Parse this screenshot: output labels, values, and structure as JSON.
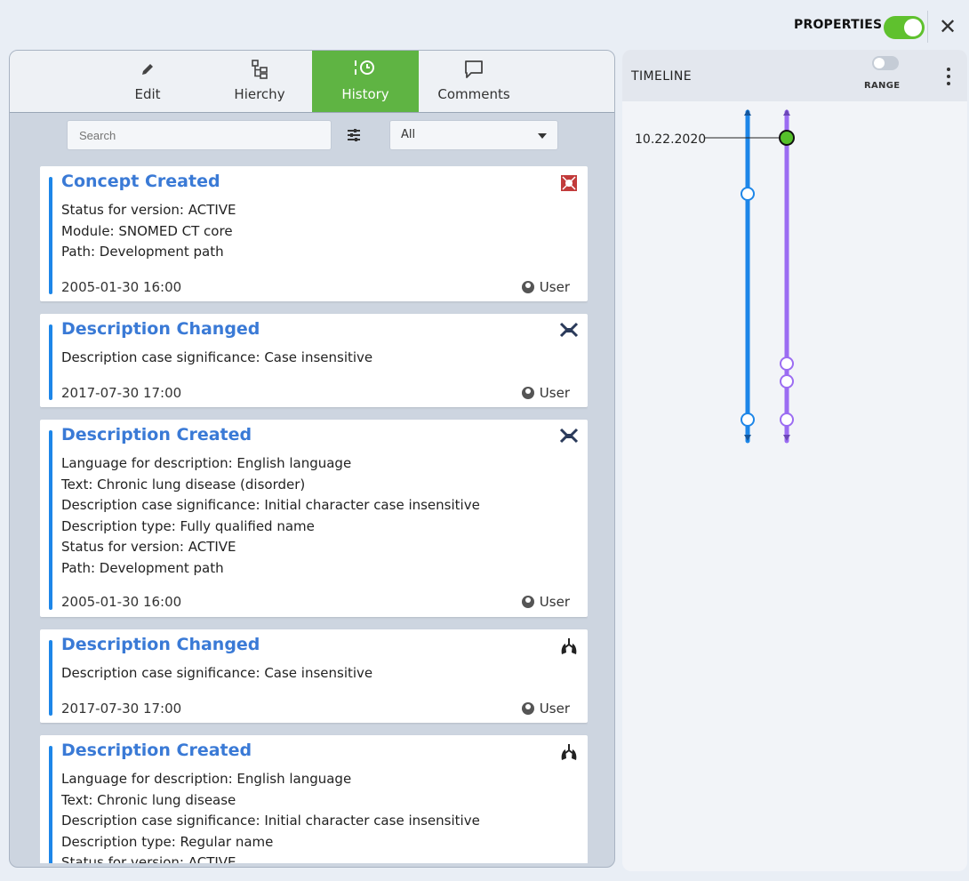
{
  "topbar": {
    "properties_label": "PROPERTIES",
    "properties_on": true,
    "close_glyph": "✕"
  },
  "tabs": [
    {
      "label": "Edit",
      "icon": "pencil-icon",
      "active": false
    },
    {
      "label": "Hierchy",
      "icon": "hierarchy-icon",
      "active": false
    },
    {
      "label": "History",
      "icon": "history-icon",
      "active": true
    },
    {
      "label": "Comments",
      "icon": "comment-icon",
      "active": false
    }
  ],
  "search": {
    "placeholder": "Search"
  },
  "filter": {
    "selected": "All"
  },
  "history": [
    {
      "title": "Concept Created",
      "icon": "concept-icon",
      "lines": [
        "Status for version: ACTIVE",
        "Module: SNOMED CT core",
        "Path: Development path"
      ],
      "date": "2005-01-30 16:00",
      "user": "User"
    },
    {
      "title": "Description Changed",
      "icon": "description-icon",
      "lines": [
        "Description case significance: Case insensitive"
      ],
      "date": "2017-07-30 17:00",
      "user": "User"
    },
    {
      "title": "Description Created",
      "icon": "description-icon",
      "lines": [
        "Language for description: English language",
        "Text: Chronic lung disease (disorder)",
        "Description case significance: Initial character case insensitive",
        "Description type: Fully qualified name",
        "Status for version: ACTIVE",
        "Path: Development path"
      ],
      "date": "2005-01-30 16:00",
      "user": "User"
    },
    {
      "title": "Description Changed",
      "icon": "lung-icon",
      "lines": [
        "Description case significance: Case insensitive"
      ],
      "date": "2017-07-30 17:00",
      "user": "User"
    },
    {
      "title": "Description Created",
      "icon": "lung-icon",
      "lines": [
        "Language for description: English language",
        "Text: Chronic lung disease",
        "Description case significance: Initial character case insensitive",
        "Description type: Regular name",
        "Status for version: ACTIVE"
      ],
      "date": "",
      "user": ""
    }
  ],
  "timeline": {
    "title": "TIMELINE",
    "range_label": "RANGE",
    "range_on": false,
    "date_marker": "10.22.2020",
    "colors": {
      "blue": "#1d86e8",
      "purple": "#9b6cf2",
      "green": "#55c02a"
    }
  }
}
